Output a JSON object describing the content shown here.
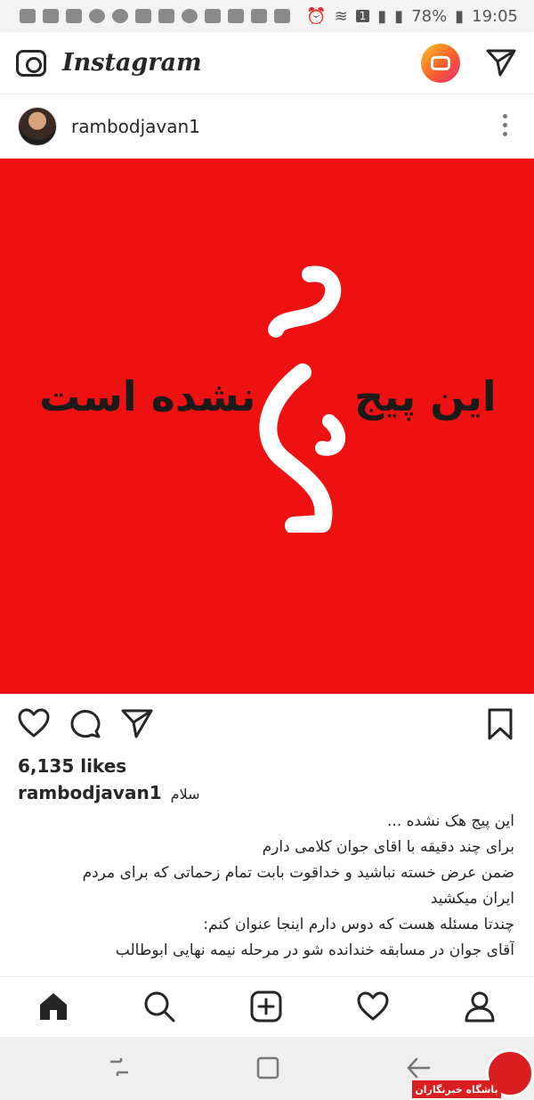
{
  "status_bar": {
    "battery": "78%",
    "time": "19:05",
    "sim_badge": "1"
  },
  "app": {
    "name": "Instagram",
    "icons": [
      "camera-icon",
      "igtv-icon",
      "direct-send-icon"
    ]
  },
  "post": {
    "username": "rambodjavan1",
    "image": {
      "background": "#ee1111",
      "text_right": "این پیج",
      "text_left": "نشده است",
      "text_center_glyph": "هک"
    },
    "likes": "6,135 likes",
    "caption_first": "سلام",
    "caption_lines": [
      "این پیج هک نشده ...",
      "برای چند دقیقه با اقای جوان کلامی دارم",
      "ضمن عرض خسته نباشید و خداقوت بابت تمام زحماتی که برای مردم",
      "ایران میکشید",
      "چندتا مسئله هست که دوس دارم اینجا عنوان کنم:",
      "آقای جوان در مسابقه خندانده شو در مرحله نیمه نهایی ابوطالب"
    ]
  },
  "bottom_nav": [
    "home-icon",
    "search-icon",
    "add-post-icon",
    "activity-heart-icon",
    "profile-icon"
  ],
  "watermark": {
    "text": "باشگاه خبرنگاران"
  },
  "colors": {
    "accent_red": "#ee1111",
    "text": "#262626"
  }
}
